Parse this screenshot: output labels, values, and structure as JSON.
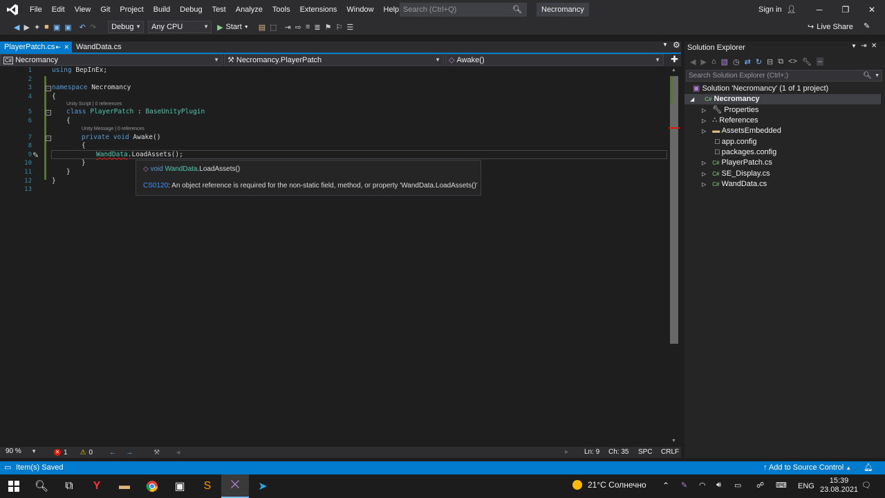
{
  "titlebar": {
    "menu": [
      "File",
      "Edit",
      "View",
      "Git",
      "Project",
      "Build",
      "Debug",
      "Test",
      "Analyze",
      "Tools",
      "Extensions",
      "Window",
      "Help"
    ],
    "search_placeholder": "Search (Ctrl+Q)",
    "project_title": "Necromancy",
    "sign_in": "Sign in"
  },
  "toolbar": {
    "config": "Debug",
    "platform": "Any CPU",
    "start": "Start",
    "live_share": "Live Share"
  },
  "tabs": [
    {
      "label": "PlayerPatch.cs",
      "active": true
    },
    {
      "label": "WandData.cs",
      "active": false
    }
  ],
  "navbar": {
    "project": "Necromancy",
    "class": "Necromancy.PlayerPatch",
    "member": "Awake()"
  },
  "code": {
    "line_numbers": [
      "1",
      "2",
      "3",
      "4",
      "5",
      "6",
      "7",
      "8",
      "9",
      "10",
      "11",
      "12",
      "13"
    ],
    "hint_class": "Unity Script | 0 references",
    "hint_method": "Unity Message | 0 references"
  },
  "tooltip": {
    "signature_prefix": "void ",
    "signature_type": "WandData",
    "signature_rest": ".LoadAssets()",
    "error_code": "CS0120",
    "error_text": ": An object reference is required for the non-static field, method, or property 'WandData.LoadAssets()'"
  },
  "editor_status": {
    "zoom": "90 %",
    "errors": "1",
    "warnings": "0",
    "line": "Ln: 9",
    "col": "Ch: 35",
    "mode": "SPC",
    "eol": "CRLF"
  },
  "solution_explorer": {
    "title": "Solution Explorer",
    "search_placeholder": "Search Solution Explorer (Ctrl+;)",
    "solution": "Solution 'Necromancy' (1 of 1 project)",
    "project": "Necromancy",
    "items": [
      "Properties",
      "References",
      "AssetsEmbedded",
      "app.config",
      "packages.config",
      "PlayerPatch.cs",
      "SE_Display.cs",
      "WandData.cs"
    ]
  },
  "status": {
    "message": "Item(s) Saved",
    "source_control": "Add to Source Control"
  },
  "taskbar": {
    "weather": "21°C  Солнечно",
    "lang": "ENG",
    "time": "15:39",
    "date": "23.08.2021"
  },
  "colors": {
    "accent": "#007acc",
    "error": "#e51400",
    "warning": "#ffcc00"
  }
}
